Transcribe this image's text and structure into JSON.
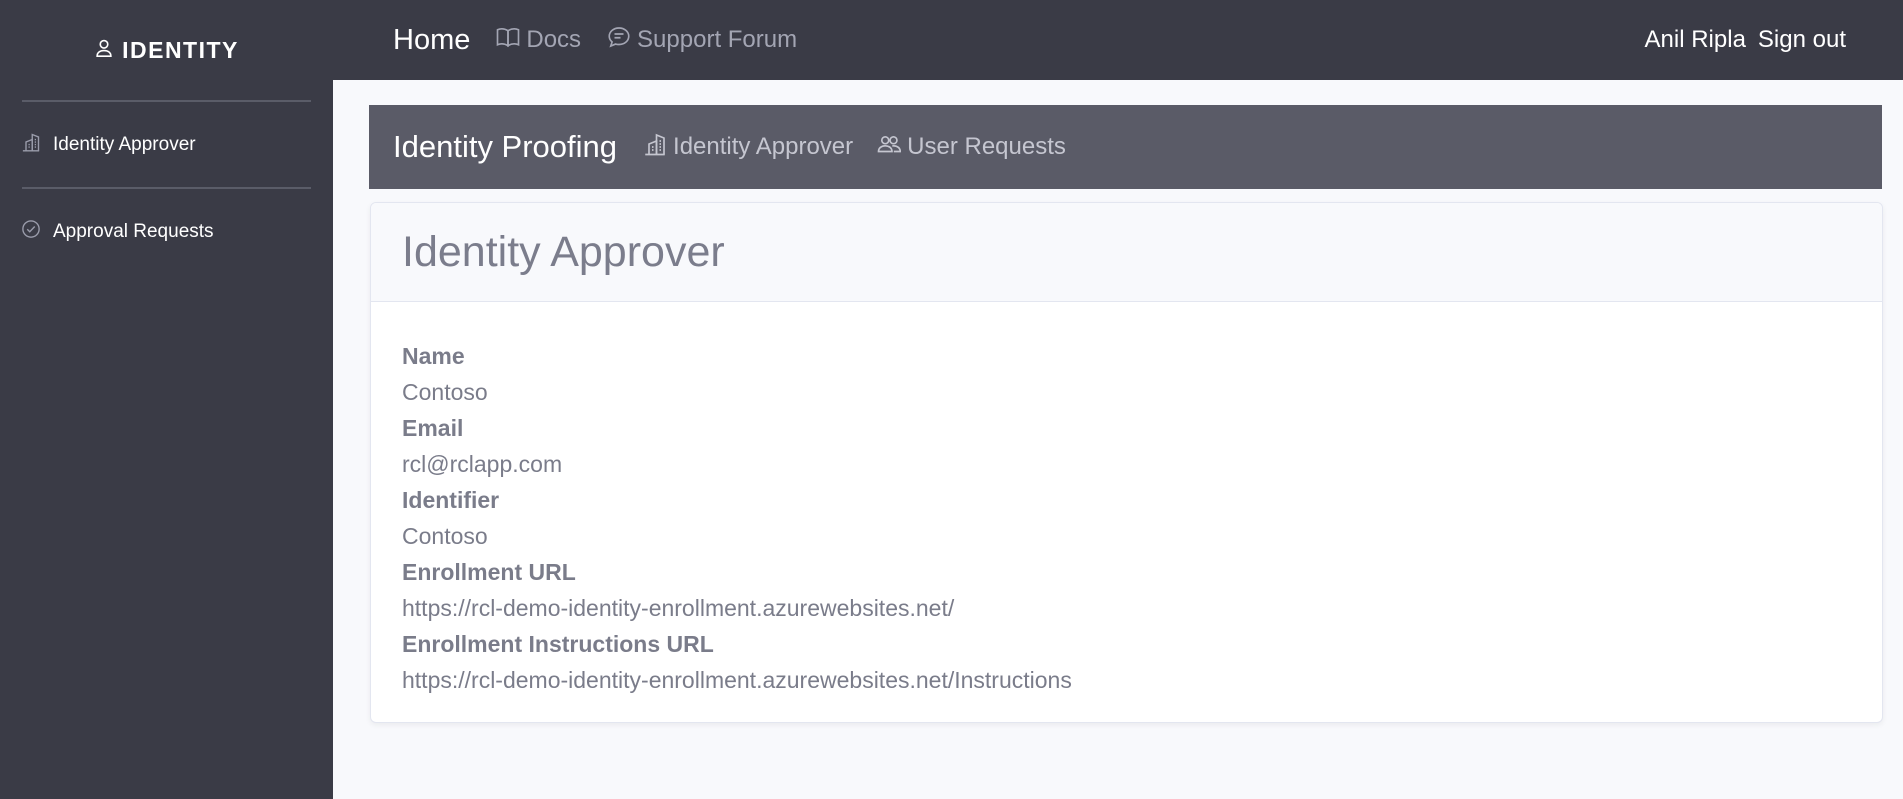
{
  "brand": {
    "name": "IDENTITY",
    "icon": "person-icon"
  },
  "sidebar": {
    "items": [
      {
        "label": "Identity Approver",
        "icon": "building-icon"
      },
      {
        "label": "Approval Requests",
        "icon": "check-circle-icon"
      }
    ]
  },
  "topnav": {
    "home": "Home",
    "docs": "Docs",
    "support": "Support Forum",
    "user": "Anil Ripla",
    "signout": "Sign out"
  },
  "subnav": {
    "title": "Identity Proofing",
    "links": [
      {
        "label": "Identity Approver",
        "icon": "building-icon"
      },
      {
        "label": "User Requests",
        "icon": "people-icon"
      }
    ]
  },
  "card": {
    "title": "Identity Approver",
    "fields": [
      {
        "label": "Name",
        "value": "Contoso"
      },
      {
        "label": "Email",
        "value": "rcl@rclapp.com"
      },
      {
        "label": "Identifier",
        "value": "Contoso"
      },
      {
        "label": "Enrollment URL",
        "value": "https://rcl-demo-identity-enrollment.azurewebsites.net/"
      },
      {
        "label": "Enrollment Instructions URL",
        "value": "https://rcl-demo-identity-enrollment.azurewebsites.net/Instructions"
      }
    ]
  },
  "colors": {
    "sidebar_bg": "#3a3b46",
    "subnav_bg": "#5a5b67",
    "page_bg": "#f8f9fc",
    "text_muted": "#7a7c8a"
  }
}
